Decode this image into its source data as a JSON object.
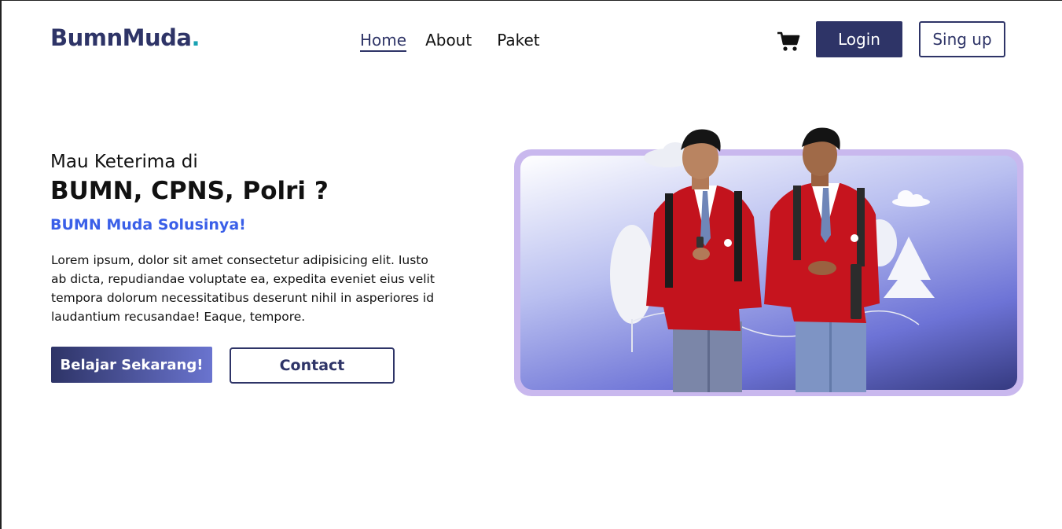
{
  "header": {
    "logo_part1": "BumnMuda",
    "logo_part2": ".",
    "nav": [
      {
        "label": "Home",
        "active": true
      },
      {
        "label": "About",
        "active": false
      },
      {
        "label": "Paket",
        "active": false
      }
    ],
    "cart_icon": "shopping-cart-icon",
    "login_label": "Login",
    "signup_label": "Sing up"
  },
  "hero": {
    "pre_title": "Mau Keterima di",
    "title": "BUMN, CPNS, Polri ?",
    "subtitle": "BUMN Muda Solusinya!",
    "body": "Lorem ipsum, dolor sit amet consectetur adipisicing elit. Iusto ab dicta, repudiandae voluptate ea, expedita eveniet eius velit tempora dolorum necessitatibus deserunt nihil in asperiores id laudantium recusandae! Eaque, tempore.",
    "cta_primary": "Belajar Sekarang!",
    "cta_secondary": "Contact"
  },
  "colors": {
    "brand_navy": "#2e3467",
    "brand_teal": "#1aa2b3",
    "accent_blue": "#3a5fe8",
    "frame_lavender": "#c9b8ee"
  }
}
